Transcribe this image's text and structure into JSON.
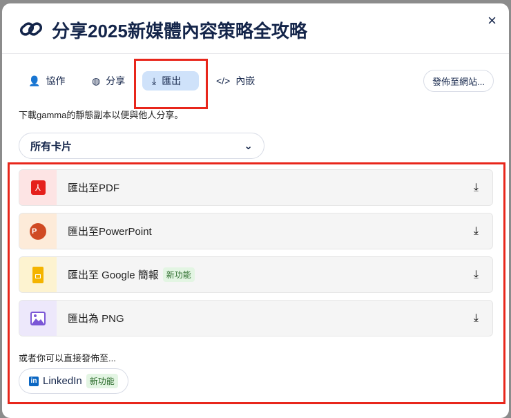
{
  "dialog": {
    "title": "分享2025新媒體內容策略全攻略",
    "close_label": "×"
  },
  "tabs": [
    {
      "label": "協作",
      "icon": "user-plus-icon"
    },
    {
      "label": "分享",
      "icon": "globe-icon"
    },
    {
      "label": "匯出",
      "icon": "download-icon",
      "active": true
    },
    {
      "label": "內嵌",
      "icon": "code-icon"
    }
  ],
  "publish_button": "發佈至網站...",
  "description": "下載gamma的靜態副本以便與他人分享。",
  "card_select": {
    "value": "所有卡片"
  },
  "exports": [
    {
      "label": "匯出至PDF",
      "icon": "pdf-icon",
      "color": "#fde4e4"
    },
    {
      "label": "匯出至PowerPoint",
      "icon": "powerpoint-icon",
      "color": "#fdebd9"
    },
    {
      "label": "匯出至 Google 簡報",
      "icon": "google-slides-icon",
      "color": "#fdf3d0",
      "badge": "新功能"
    },
    {
      "label": "匯出為 PNG",
      "icon": "image-icon",
      "color": "#ede8fb"
    }
  ],
  "publish_note": "或者你可以直接發佈至...",
  "linkedin": {
    "label": "LinkedIn",
    "badge": "新功能"
  }
}
